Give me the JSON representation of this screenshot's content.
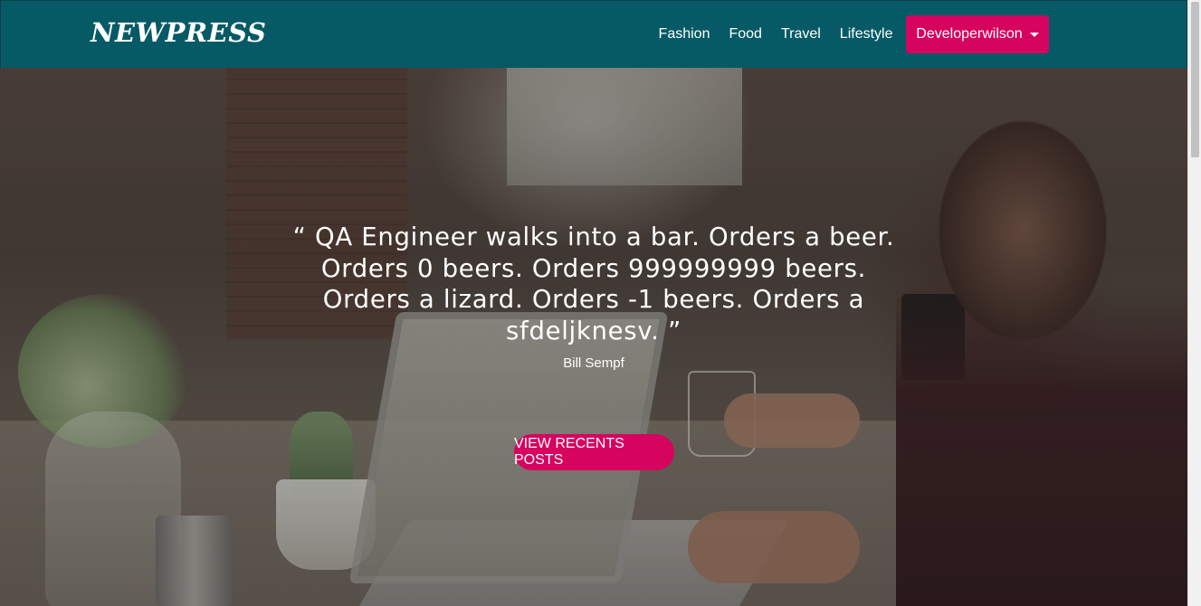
{
  "navbar": {
    "brand": "NEWPRESS",
    "links": [
      "Fashion",
      "Food",
      "Travel",
      "Lifestyle"
    ],
    "user_menu_label": "Developerwilson",
    "accent_color": "#d6035f",
    "background_color": "#065a66"
  },
  "hero": {
    "quote_lines": [
      "“ QA Engineer walks into a bar. Orders a beer.",
      "Orders 0 beers. Orders 999999999 beers.",
      "Orders a lizard. Orders -1 beers. Orders a",
      "sfdeljknesv. ”"
    ],
    "author": "Bill Sempf",
    "cta_label": "VIEW RECENTS POSTS"
  },
  "icons": {
    "dropdown": "chevron-down-icon"
  }
}
